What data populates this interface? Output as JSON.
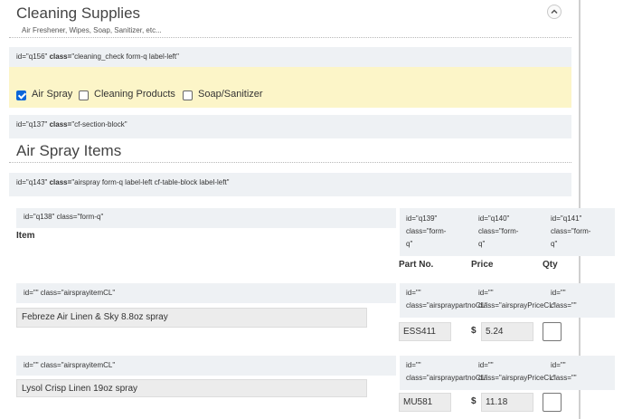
{
  "section": {
    "title": "Cleaning Supplies",
    "subtitle": "Air Freshener, Wipes, Soap, Sanitizer, etc...",
    "collapse_icon": "chevron-up-icon"
  },
  "q156": {
    "id_text": "id=\"q156\"",
    "class_key": "class=",
    "class_val": "\"cleaning_check form-q label-left\""
  },
  "checks": [
    {
      "label": "Air Spray",
      "checked": true
    },
    {
      "label": "Cleaning Products",
      "checked": false
    },
    {
      "label": "Soap/Sanitizer",
      "checked": false
    }
  ],
  "q137": {
    "id_text": "id=\"q137\"",
    "class_key": "class=",
    "class_val": "\"cf-section-block\""
  },
  "air_spray_title": "Air Spray Items",
  "q143": {
    "id_text": "id=\"q143\"",
    "class_key": "class=",
    "class_val": "\"airspray form-q label-left cf-table-block label-left\""
  },
  "table": {
    "q138": {
      "line1": "id=\"q138\" class=\"form-q\""
    },
    "q139": {
      "line1": "id=\"q139\"",
      "line2": "class=\"form-",
      "line3": "q\""
    },
    "q140": {
      "line1": "id=\"q140\"",
      "line2": "class=\"form-",
      "line3": "q\""
    },
    "q141": {
      "line1": "id=\"q141\"",
      "line2": "class=\"form-",
      "line3": "q\""
    },
    "headers": {
      "item": "Item",
      "part": "Part No.",
      "price": "Price",
      "qty": "Qty"
    },
    "rows": [
      {
        "attr": "id=\"\" class=\"airsprayitemCL\"",
        "part_attr_l1": "id=\"\"",
        "part_attr_l2": "class=\"airspraypartnoCL\"",
        "price_attr_l1": "id=\"\"",
        "price_attr_l2": "class=\"airsprayPriceCL\"",
        "qty_attr_l1": "id=\"\"",
        "qty_attr_l2": "class=\"\"",
        "item": "Febreze Air Linen & Sky 8.8oz spray",
        "part": "ESS411",
        "currency": "$",
        "price": "5.24",
        "qty": ""
      },
      {
        "attr": "id=\"\" class=\"airsprayitemCL\"",
        "part_attr_l1": "id=\"\"",
        "part_attr_l2": "class=\"airspraypartnoCL\"",
        "price_attr_l1": "id=\"\"",
        "price_attr_l2": "class=\"airsprayPriceCL\"",
        "qty_attr_l1": "id=\"\"",
        "qty_attr_l2": "class=\"\"",
        "item": "Lysol Crisp Linen 19oz spray",
        "part": "MU581",
        "currency": "$",
        "price": "11.18",
        "qty": ""
      }
    ]
  }
}
